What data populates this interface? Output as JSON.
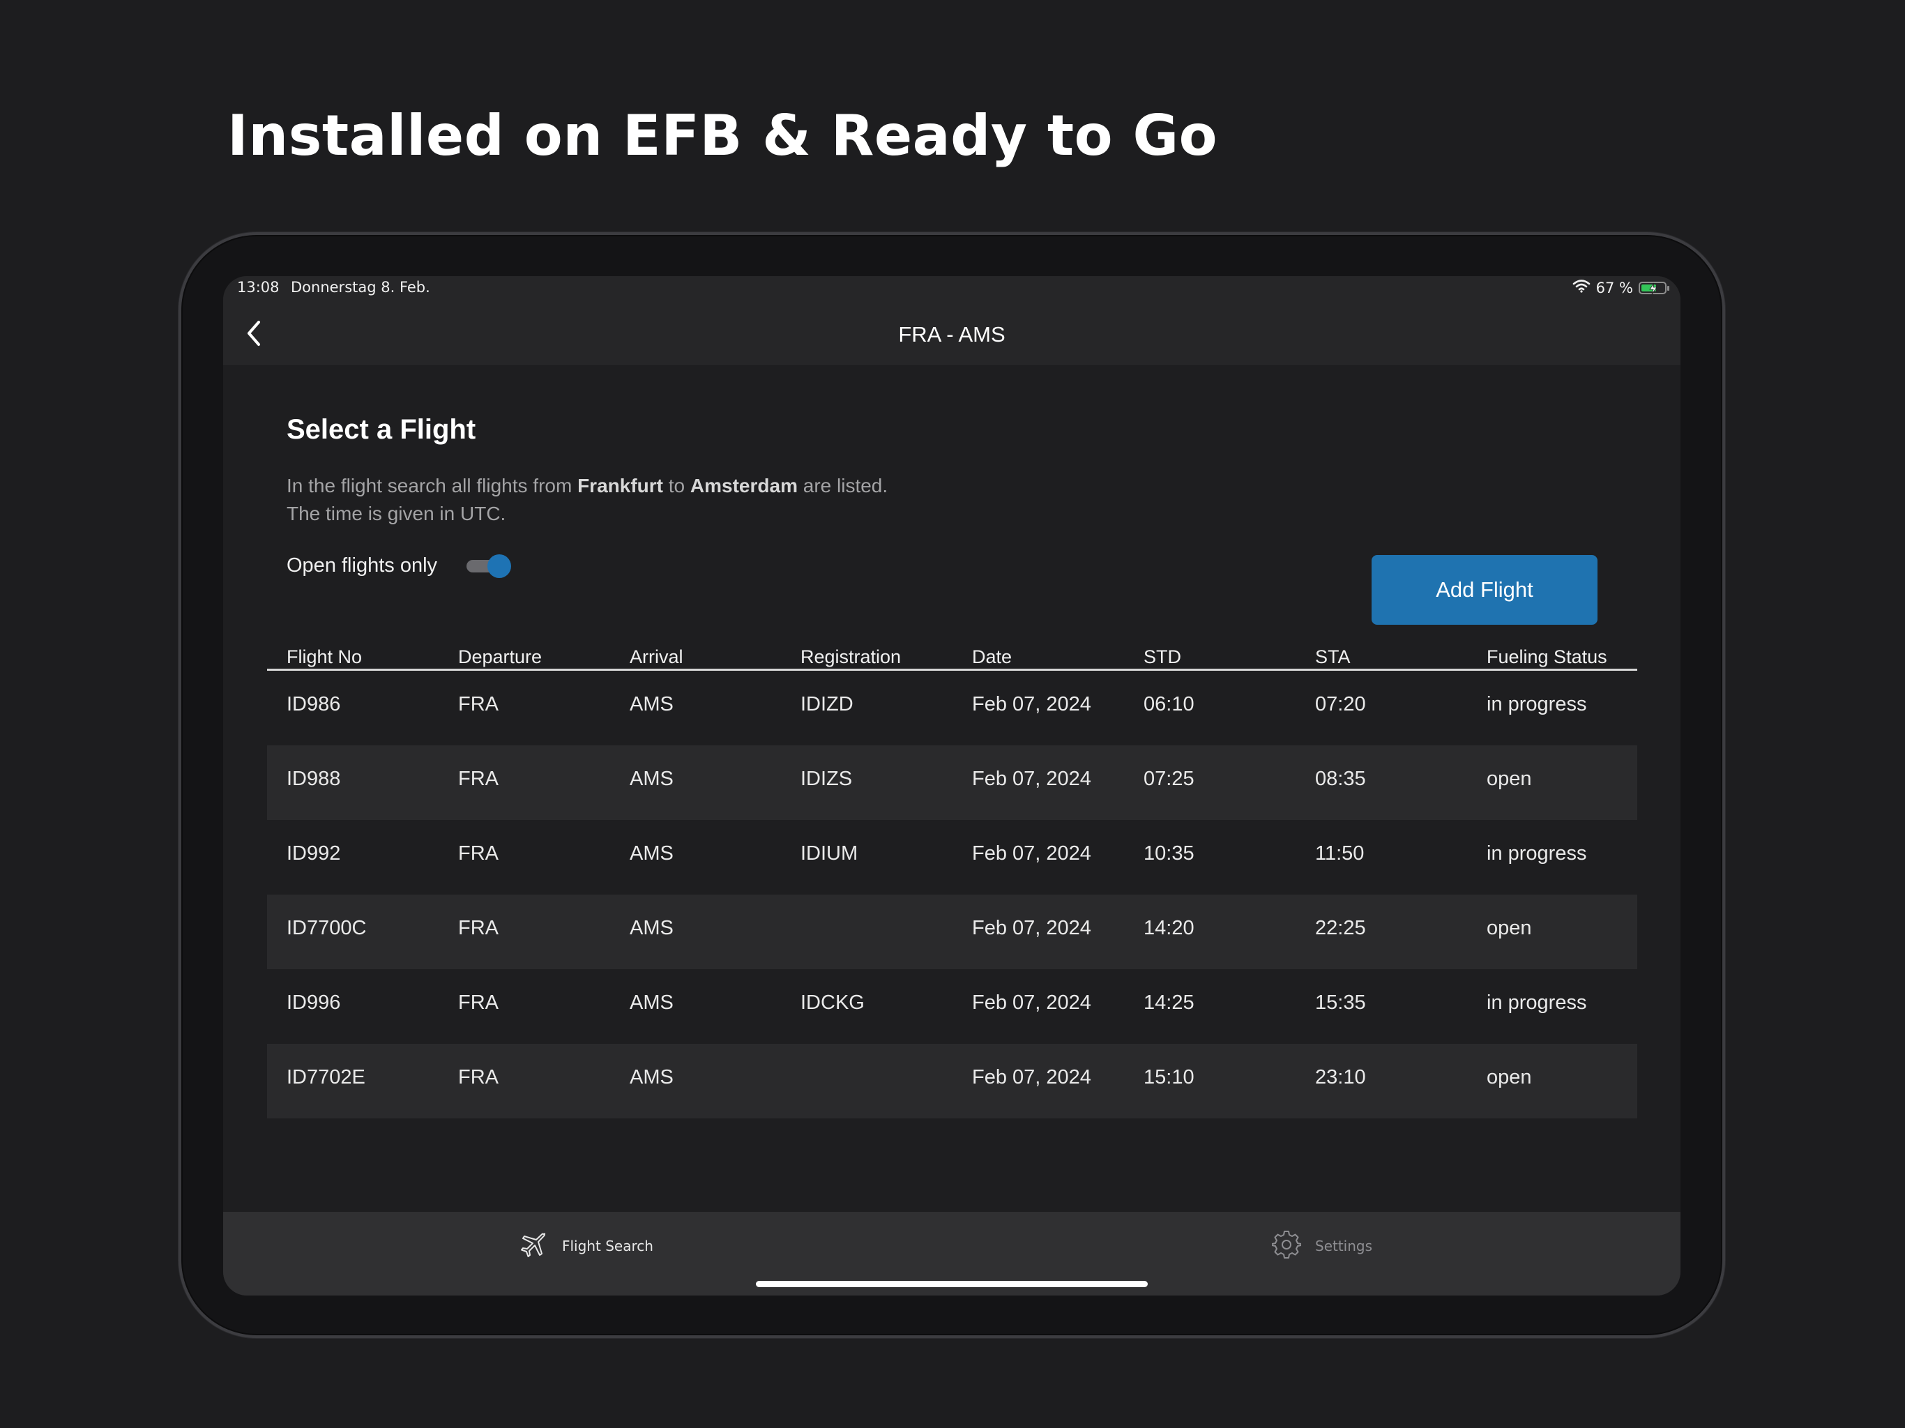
{
  "headline": "Installed on EFB & Ready to Go",
  "status_bar": {
    "time": "13:08",
    "date": "Donnerstag 8. Feb.",
    "battery_text": "67 %",
    "battery_level": 0.67,
    "icons": [
      "wifi-icon",
      "battery-charging-icon"
    ]
  },
  "nav": {
    "title": "FRA - AMS",
    "back_icon": "chevron-left-icon"
  },
  "main": {
    "title": "Select a Flight",
    "desc_1_pre": "In the flight search all flights from ",
    "desc_1_from": "Frankfurt",
    "desc_1_mid": " to ",
    "desc_1_to": "Amsterdam",
    "desc_1_post": " are listed.",
    "desc_2": "The time is given in UTC.",
    "toggle_label": "Open flights only",
    "toggle_on": true,
    "add_button": "Add Flight",
    "accent_color": "#1f73b0"
  },
  "table": {
    "columns": [
      "Flight No",
      "Departure",
      "Arrival",
      "Registration",
      "Date",
      "STD",
      "STA",
      "Fueling Status"
    ],
    "rows": [
      [
        "ID986",
        "FRA",
        "AMS",
        "IDIZD",
        "Feb 07, 2024",
        "06:10",
        "07:20",
        "in progress"
      ],
      [
        "ID988",
        "FRA",
        "AMS",
        "IDIZS",
        "Feb 07, 2024",
        "07:25",
        "08:35",
        "open"
      ],
      [
        "ID992",
        "FRA",
        "AMS",
        "IDIUM",
        "Feb 07, 2024",
        "10:35",
        "11:50",
        "in progress"
      ],
      [
        "ID7700C",
        "FRA",
        "AMS",
        "",
        "Feb 07, 2024",
        "14:20",
        "22:25",
        "open"
      ],
      [
        "ID996",
        "FRA",
        "AMS",
        "IDCKG",
        "Feb 07, 2024",
        "14:25",
        "15:35",
        "in progress"
      ],
      [
        "ID7702E",
        "FRA",
        "AMS",
        "",
        "Feb 07, 2024",
        "15:10",
        "23:10",
        "open"
      ]
    ]
  },
  "tabbar": {
    "flight_search": "Flight Search",
    "flight_search_icon": "airplane-icon",
    "settings": "Settings",
    "settings_icon": "gear-icon"
  }
}
